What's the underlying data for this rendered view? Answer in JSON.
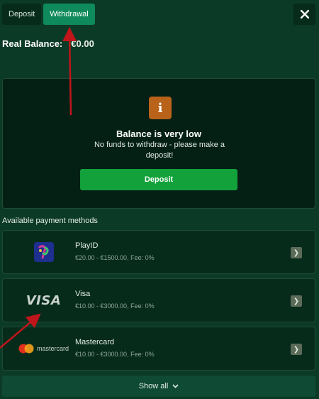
{
  "tabs": [
    {
      "label": "Deposit",
      "active": false
    },
    {
      "label": "Withdrawal",
      "active": true
    }
  ],
  "close_icon": "close-icon",
  "balance": {
    "label": "Real Balance:",
    "value": "€0.00"
  },
  "notice": {
    "icon": "info-icon",
    "icon_glyph": "i",
    "title": "Balance is very low",
    "message": "No funds to withdraw - please make a deposit!",
    "button_label": "Deposit"
  },
  "payment_methods": {
    "heading": "Available payment methods",
    "items": [
      {
        "name": "PlayID",
        "limits": "€20.00 - €1500.00, Fee: 0%",
        "logo": "playid-logo"
      },
      {
        "name": "Visa",
        "limits": "€10.00 - €3000.00, Fee: 0%",
        "logo": "visa-logo",
        "logo_text": "VISA"
      },
      {
        "name": "Mastercard",
        "limits": "€10.00 - €3000.00, Fee: 0%",
        "logo": "mastercard-logo",
        "logo_text": "mastercard"
      }
    ]
  },
  "show_all": {
    "label": "Show all"
  },
  "colors": {
    "background": "#0b3a26",
    "active_tab": "#0f8a5c",
    "deposit_button": "#12a13a",
    "info_badge": "#b8621a",
    "annotation_arrow": "#c0151b"
  }
}
